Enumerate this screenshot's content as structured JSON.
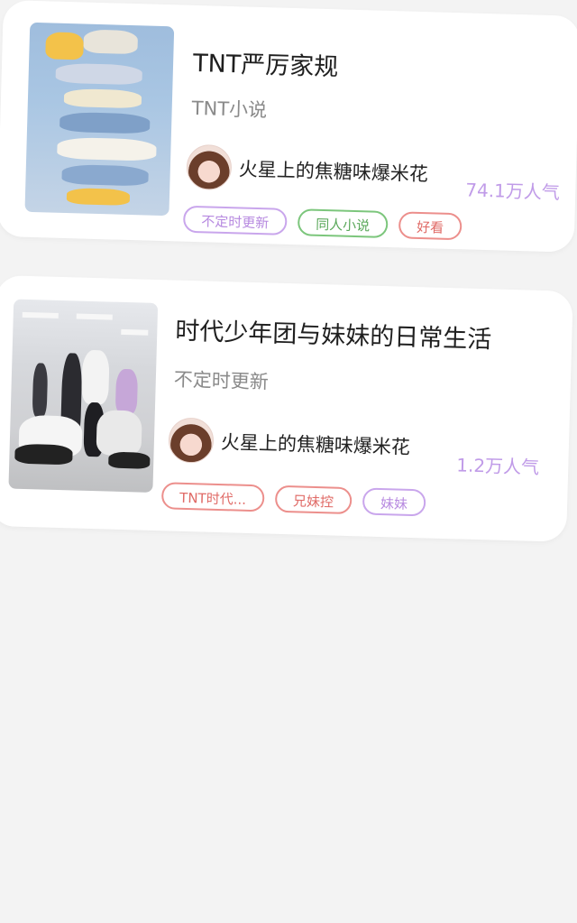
{
  "colors": {
    "background": "#f3f3f3",
    "card": "#ffffff",
    "popularity": "#c09be8",
    "tag_purple": "#c9a6ec",
    "tag_green": "#7cc67c",
    "tag_red": "#ec8f8c"
  },
  "books": [
    {
      "title": "TNT严厉家规",
      "subtitle": "TNT小说",
      "author": "火星上的焦糖味爆米花",
      "popularity": "74.1万人气",
      "tags": [
        {
          "label": "不定时更新",
          "color": "purple"
        },
        {
          "label": "同人小说",
          "color": "green"
        },
        {
          "label": "好看",
          "color": "red"
        }
      ]
    },
    {
      "title": "时代少年团与妹妹的日常生活",
      "subtitle": "不定时更新",
      "author": "火星上的焦糖味爆米花",
      "popularity": "1.2万人气",
      "tags": [
        {
          "label": "TNT时代...",
          "color": "red"
        },
        {
          "label": "兄妹控",
          "color": "red"
        },
        {
          "label": "妹妹",
          "color": "purple"
        }
      ]
    }
  ]
}
